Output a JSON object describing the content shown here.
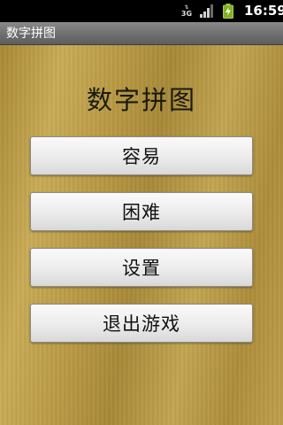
{
  "status_bar": {
    "network_type": "3G",
    "time": "16:59",
    "icons": [
      "network-type-icon",
      "signal-strength-icon",
      "battery-charging-icon"
    ]
  },
  "app": {
    "title": "数字拼图"
  },
  "main": {
    "heading": "数字拼图",
    "buttons": [
      {
        "label": "容易"
      },
      {
        "label": "困难"
      },
      {
        "label": "设置"
      },
      {
        "label": "退出游戏"
      }
    ]
  },
  "colors": {
    "background_gold": "#b99a45",
    "button_face": "#ececec",
    "title_bar": "#6c6c6c"
  }
}
